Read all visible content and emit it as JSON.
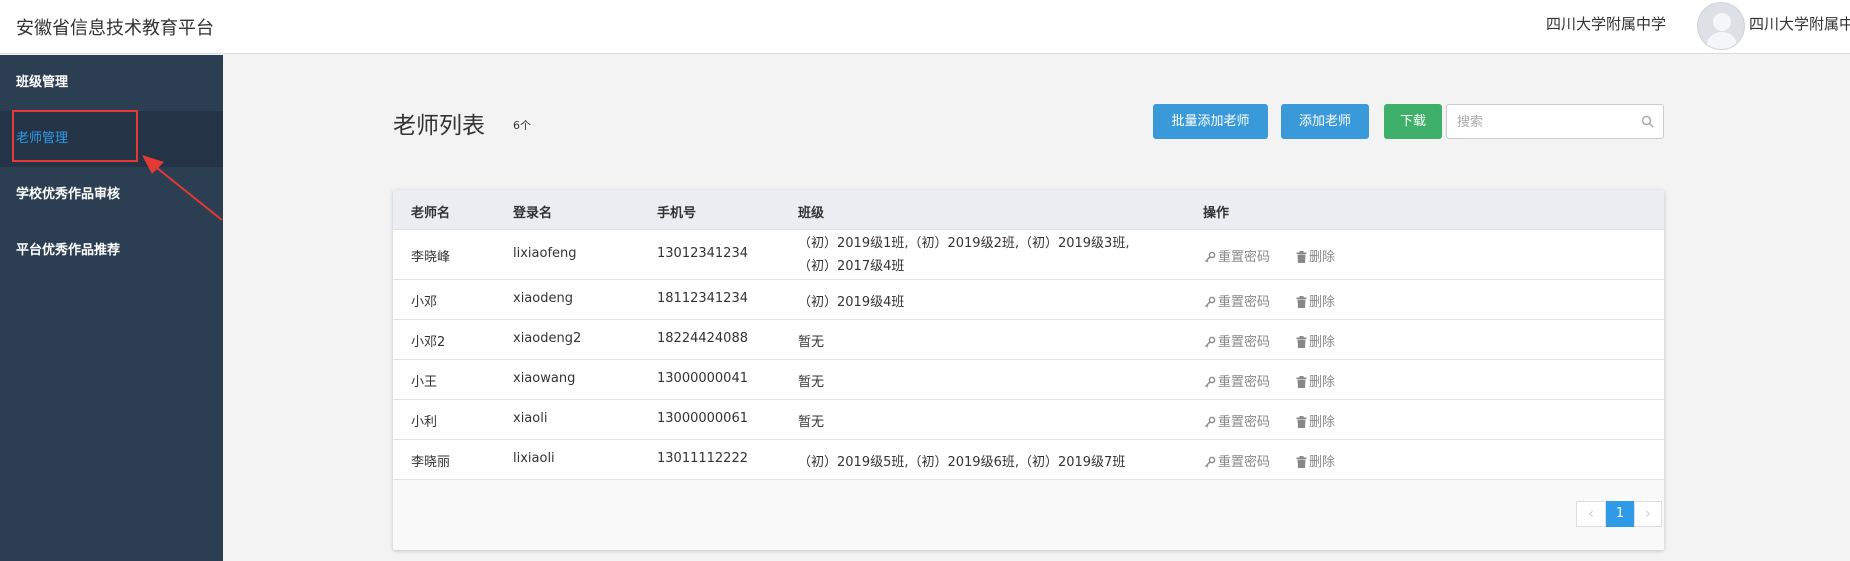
{
  "header": {
    "title": "安徽省信息技术教育平台",
    "school": "四川大学附属中学",
    "username": "四川大学附属中"
  },
  "sidebar": {
    "items": [
      {
        "label": "班级管理"
      },
      {
        "label": "老师管理",
        "active": true
      },
      {
        "label": "学校优秀作品审核"
      },
      {
        "label": "平台优秀作品推荐"
      }
    ]
  },
  "main": {
    "title": "老师列表",
    "count": "6个",
    "buttons": {
      "batch_add": "批量添加老师",
      "add": "添加老师",
      "download": "下载"
    },
    "search": {
      "placeholder": "搜索",
      "value": ""
    },
    "table": {
      "headers": [
        "老师名",
        "登录名",
        "手机号",
        "班级",
        "操作"
      ],
      "rows": [
        {
          "name": "李晓峰",
          "login": "lixiaofeng",
          "phone": "13012341234",
          "classes": [
            "（初）2019级1班,（初）2019级2班,（初）2019级3班,",
            "（初）2017级4班"
          ]
        },
        {
          "name": "小邓",
          "login": "xiaodeng",
          "phone": "18112341234",
          "classes": [
            "（初）2019级4班"
          ]
        },
        {
          "name": "小邓2",
          "login": "xiaodeng2",
          "phone": "18224424088",
          "classes": [
            "暂无"
          ]
        },
        {
          "name": "小王",
          "login": "xiaowang",
          "phone": "13000000041",
          "classes": [
            "暂无"
          ]
        },
        {
          "name": "小利",
          "login": "xiaoli",
          "phone": "13000000061",
          "classes": [
            "暂无"
          ]
        },
        {
          "name": "李晓丽",
          "login": "lixiaoli",
          "phone": "13011112222",
          "classes": [
            "（初）2019级5班,（初）2019级6班,（初）2019级7班"
          ]
        }
      ],
      "actions": {
        "reset": "重置密码",
        "delete": "删除"
      }
    },
    "pagination": {
      "prev": "‹",
      "current": "1",
      "next": "›"
    }
  },
  "colors": {
    "sidebar_bg": "#2c3e52",
    "active_text": "#2e9ae8",
    "primary_button": "#3a9ad9",
    "download_button": "#3fb06b",
    "annotation_red": "#e53935"
  }
}
